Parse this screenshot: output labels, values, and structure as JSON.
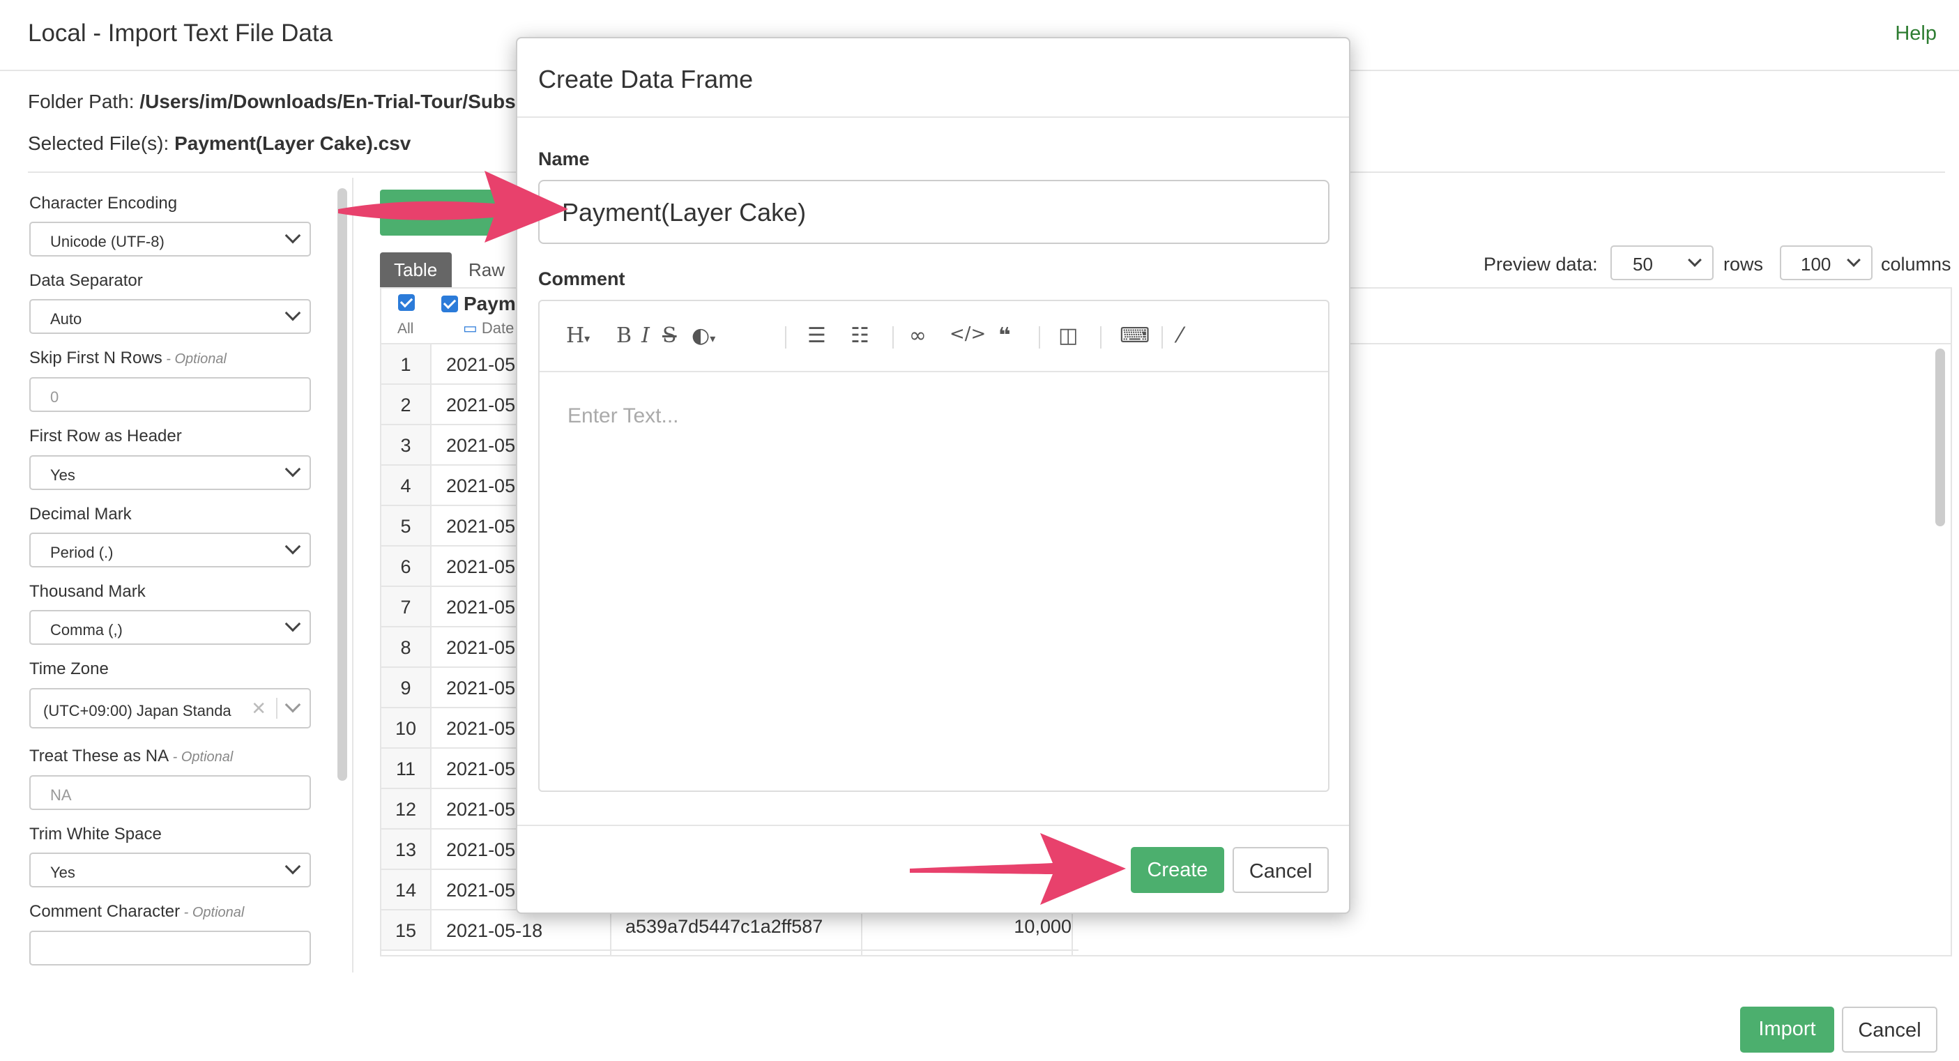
{
  "header": {
    "title": "Local - Import Text File Data",
    "help": "Help"
  },
  "folder_path": {
    "label": "Folder Path:",
    "value": "/Users/im/Downloads/En-Trial-Tour/Subs"
  },
  "selected_files": {
    "label": "Selected File(s):",
    "value": "Payment(Layer Cake).csv"
  },
  "sidebar": {
    "char_encoding": {
      "label": "Character Encoding",
      "value": "Unicode (UTF-8)"
    },
    "data_separator": {
      "label": "Data Separator",
      "value": "Auto"
    },
    "skip_rows": {
      "label": "Skip First N Rows",
      "optional": " - Optional",
      "placeholder": "0"
    },
    "first_row_header": {
      "label": "First Row as Header",
      "value": "Yes"
    },
    "decimal_mark": {
      "label": "Decimal Mark",
      "value": "Period (.)"
    },
    "thousand_mark": {
      "label": "Thousand Mark",
      "value": "Comma (,)"
    },
    "time_zone": {
      "label": "Time Zone",
      "value": "(UTC+09:00) Japan Standa"
    },
    "treat_na": {
      "label": "Treat These as NA",
      "optional": " - Optional",
      "placeholder": "NA"
    },
    "trim_ws": {
      "label": "Trim White Space",
      "value": "Yes"
    },
    "comment_char": {
      "label": "Comment Character",
      "optional": " - Optional"
    }
  },
  "preview": {
    "tabs": [
      "Table",
      "Raw"
    ],
    "label": "Preview data:",
    "rows_value": "50",
    "rows_label": "rows",
    "cols_value": "100",
    "cols_label": "columns",
    "all_label": "All",
    "col1_name": "Paym",
    "col1_type": "Date",
    "row_numbers": [
      "1",
      "2",
      "3",
      "4",
      "5",
      "6",
      "7",
      "8",
      "9",
      "10",
      "11",
      "12",
      "13",
      "14",
      "15"
    ],
    "row_dates": [
      "2021-05",
      "2021-05",
      "2021-05",
      "2021-05",
      "2021-05",
      "2021-05",
      "2021-05",
      "2021-05",
      "2021-05",
      "2021-05",
      "2021-05",
      "2021-05",
      "2021-05",
      "2021-05",
      "2021-05-18"
    ],
    "last_row": {
      "id": "a539a7d5447c1a2ff587",
      "amount": "10,000"
    }
  },
  "footer": {
    "import": "Import",
    "cancel": "Cancel"
  },
  "modal": {
    "title": "Create Data Frame",
    "name_label": "Name",
    "name_value": "Payment(Layer Cake)",
    "comment_label": "Comment",
    "placeholder": "Enter Text...",
    "create": "Create",
    "cancel": "Cancel"
  },
  "colors": {
    "accent_green": "#4caf6e",
    "arrow_pink": "#e8416c",
    "checkbox_blue": "#2b7bd9"
  }
}
